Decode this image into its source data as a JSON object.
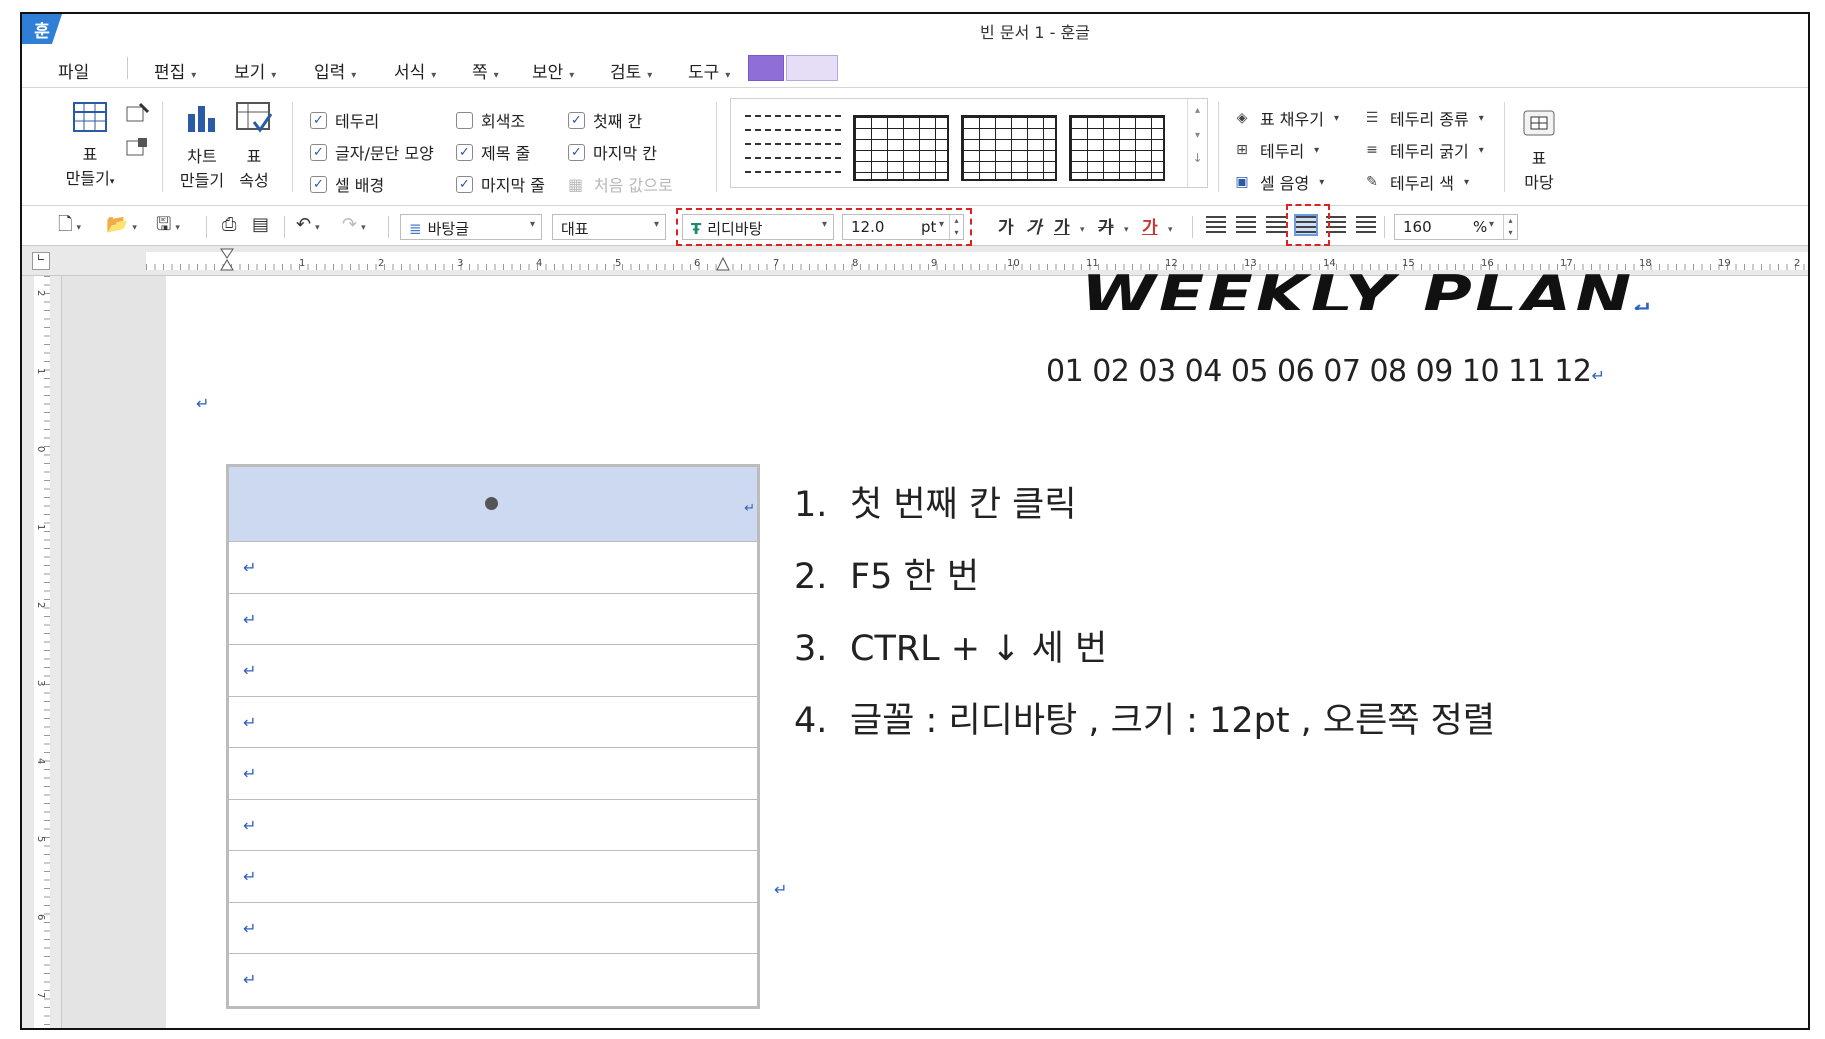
{
  "app": {
    "logo": "훈",
    "title": "빈 문서 1 - 훈글"
  },
  "menu": {
    "items": [
      {
        "label": "파일",
        "has_dropdown": false
      },
      {
        "label": "편집",
        "has_dropdown": true
      },
      {
        "label": "보기",
        "has_dropdown": true
      },
      {
        "label": "입력",
        "has_dropdown": true
      },
      {
        "label": "서식",
        "has_dropdown": true
      },
      {
        "label": "쪽",
        "has_dropdown": true
      },
      {
        "label": "보안",
        "has_dropdown": true
      },
      {
        "label": "검토",
        "has_dropdown": true
      },
      {
        "label": "도구",
        "has_dropdown": true
      }
    ]
  },
  "ribbon": {
    "make_table_top": "표",
    "make_table_bottom": "만들기",
    "chart_top": "차트",
    "chart_bottom": "만들기",
    "table_prop_top": "표",
    "table_prop_bottom": "속성",
    "checks": [
      {
        "label": "테두리",
        "checked": true,
        "disabled": false
      },
      {
        "label": "글자/문단 모양",
        "checked": true,
        "disabled": false
      },
      {
        "label": "셀 배경",
        "checked": true,
        "disabled": false
      },
      {
        "label": "회색조",
        "checked": false,
        "disabled": false
      },
      {
        "label": "제목 줄",
        "checked": true,
        "disabled": false
      },
      {
        "label": "마지막 줄",
        "checked": true,
        "disabled": false
      },
      {
        "label": "첫째 칸",
        "checked": true,
        "disabled": false
      },
      {
        "label": "마지막 칸",
        "checked": true,
        "disabled": false
      },
      {
        "label": "처음 값으로",
        "checked": false,
        "disabled": true
      }
    ],
    "fill": "표 채우기",
    "border": "테두리",
    "cell_shade": "셀 음영",
    "border_type": "테두리 종류",
    "border_width": "테두리 굵기",
    "border_color": "테두리 색",
    "table_yard_top": "표",
    "table_yard_bottom": "마당"
  },
  "format_bar": {
    "style": "바탕글",
    "lang": "대표",
    "font": "리디바탕",
    "size": "12.0",
    "unit": "pt",
    "letters": [
      "가",
      "가",
      "가",
      "가",
      "가"
    ],
    "zoom": "160",
    "zoom_unit": "%"
  },
  "ruler": {
    "numbers": [
      "1",
      "2",
      "3",
      "4",
      "5",
      "6",
      "7",
      "8",
      "9",
      "10",
      "11",
      "12",
      "13",
      "14",
      "15",
      "16",
      "17",
      "18",
      "19",
      "2"
    ],
    "vertical_numbers": [
      "2",
      "1",
      "0",
      "1",
      "2",
      "3",
      "4",
      "5",
      "6",
      "7"
    ]
  },
  "document": {
    "title": "WEEKLY PLAN",
    "months": "01 02 03 04 05 06 07 08 09 10 11 12",
    "para_mark": "↵",
    "table_rows": 10,
    "steps": [
      {
        "num": "1.",
        "text": "첫 번째 칸 클릭"
      },
      {
        "num": "2.",
        "text": "F5 한 번"
      },
      {
        "num": "3.",
        "text": "CTRL + ↓ 세 번"
      },
      {
        "num": "4.",
        "text": "글꼴 : 리디바탕 , 크기 : 12pt , 오른쪽 정렬"
      }
    ]
  },
  "colors": {
    "app_blue": "#2f7fd6",
    "selected_cell": "#cdd8f1",
    "highlight_red": "#dd2222",
    "para_mark": "#2f5fbf"
  }
}
